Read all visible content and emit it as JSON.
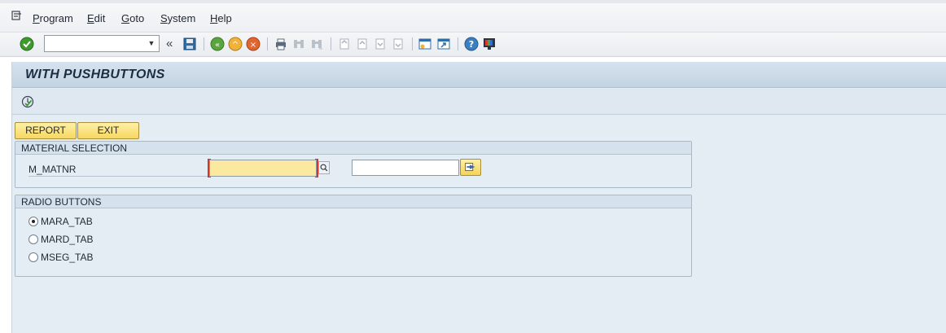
{
  "menu": {
    "items": [
      "Program",
      "Edit",
      "Goto",
      "System",
      "Help"
    ]
  },
  "toolbar": {
    "command_field_value": ""
  },
  "screen": {
    "title": "WITH PUSHBUTTONS"
  },
  "buttons": {
    "report_label": "REPORT",
    "exit_label": "EXIT"
  },
  "material_selection": {
    "header": "MATERIAL SELECTION",
    "field_label": "M_MATNR",
    "low_value": "",
    "high_value": ""
  },
  "radio_buttons": {
    "header": "RADIO BUTTONS",
    "options": [
      {
        "label": "MARA_TAB",
        "checked": true
      },
      {
        "label": "MARD_TAB",
        "checked": false
      },
      {
        "label": "MSEG_TAB",
        "checked": false
      }
    ]
  },
  "colors": {
    "button_yellow": "#f6d860",
    "workspace_bg": "#e5edf4",
    "title_bar": "#c3d3e3",
    "required_marker": "#d0352f"
  },
  "icons": [
    "menu-icon",
    "enter-icon",
    "dropdown-icon",
    "chevron-left-icon",
    "save-icon",
    "back-icon",
    "exit-icon",
    "cancel-icon",
    "print-icon",
    "find-icon",
    "find-next-icon",
    "first-page-icon",
    "previous-page-icon",
    "next-page-icon",
    "last-page-icon",
    "new-session-icon",
    "shortcut-icon",
    "help-icon",
    "layout-icon",
    "execute-icon",
    "search-help-icon",
    "multiple-selection-icon"
  ]
}
